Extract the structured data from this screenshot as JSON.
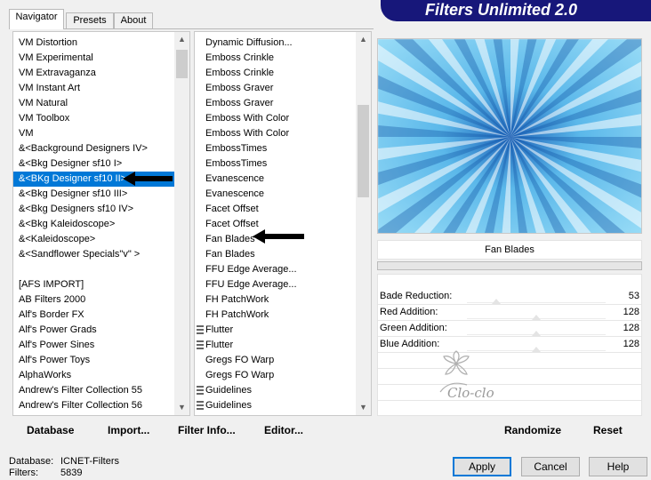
{
  "banner": {
    "title": "Filters Unlimited 2.0"
  },
  "tabs": [
    {
      "label": "Navigator",
      "active": true
    },
    {
      "label": "Presets",
      "active": false
    },
    {
      "label": "About",
      "active": false
    }
  ],
  "categories": {
    "items": [
      "VM Distortion",
      "VM Experimental",
      "VM Extravaganza",
      "VM Instant Art",
      "VM Natural",
      "VM Toolbox",
      "VM",
      "&<Background Designers IV>",
      "&<Bkg Designer sf10 I>",
      "&<BKg Designer sf10 II>",
      "&<Bkg Designer sf10 III>",
      "&<Bkg Designers sf10 IV>",
      "&<Bkg Kaleidoscope>",
      "&<Kaleidoscope>",
      "&<Sandflower Specials\"v\" >",
      "",
      "[AFS IMPORT]",
      "AB Filters 2000",
      "Alf's Border FX",
      "Alf's Power Grads",
      "Alf's Power Sines",
      "Alf's Power Toys",
      "AlphaWorks",
      "Andrew's Filter Collection 55",
      "Andrew's Filter Collection 56"
    ],
    "selected_index": 9
  },
  "filters": {
    "items": [
      "Dynamic Diffusion...",
      "Emboss Crinkle",
      "Emboss Crinkle",
      "Emboss Graver",
      "Emboss Graver",
      "Emboss With Color",
      "Emboss With Color",
      "EmbossTimes",
      "EmbossTimes",
      "Evanescence",
      "Evanescence",
      "Facet Offset",
      "Facet Offset",
      "Fan Blades",
      "Fan Blades",
      "FFU Edge Average...",
      "FFU Edge Average...",
      "FH PatchWork",
      "FH PatchWork",
      "Flutter",
      "Flutter",
      "Gregs FO Warp",
      "Gregs FO Warp",
      "Guidelines",
      "Guidelines"
    ],
    "grip_indices": [
      19,
      20,
      23,
      24
    ]
  },
  "preview": {
    "filter_name": "Fan Blades"
  },
  "params": [
    {
      "name": "Bade Reduction:",
      "value": "53",
      "level": 0.21
    },
    {
      "name": "Red Addition:",
      "value": "128",
      "level": 0.5
    },
    {
      "name": "Green Addition:",
      "value": "128",
      "level": 0.5
    },
    {
      "name": "Blue Addition:",
      "value": "128",
      "level": 0.5
    }
  ],
  "watermark": "Clo-clo",
  "toolbar": {
    "database": "Database",
    "import": "Import...",
    "filter_info": "Filter Info...",
    "editor": "Editor...",
    "randomize": "Randomize",
    "reset": "Reset"
  },
  "status": {
    "database_label": "Database:",
    "database_value": "ICNET-Filters",
    "filters_label": "Filters:",
    "filters_value": "5839"
  },
  "buttons": {
    "apply": "Apply",
    "cancel": "Cancel",
    "help": "Help"
  },
  "colors": {
    "accent": "#0078d7",
    "banner": "#17177a",
    "preview_main": "#5bb8ea"
  }
}
